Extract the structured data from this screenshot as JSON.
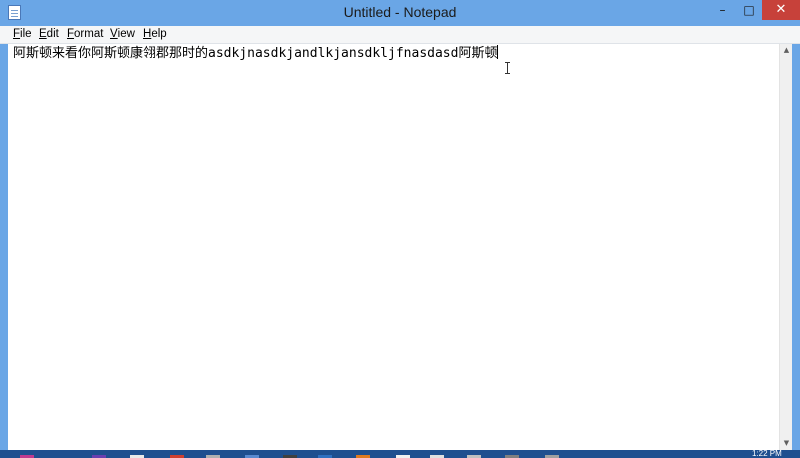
{
  "window": {
    "title": "Untitled - Notepad",
    "controls": {
      "minimize": "–",
      "maximize": "□",
      "close": "✕"
    }
  },
  "menu": {
    "items": [
      {
        "label": "File",
        "underline": "F",
        "rest": "ile"
      },
      {
        "label": "Edit",
        "underline": "E",
        "rest": "dit"
      },
      {
        "label": "Format",
        "underline": "F",
        "rest": "ormat"
      },
      {
        "label": "View",
        "underline": "V",
        "rest": "iew"
      },
      {
        "label": "Help",
        "underline": "H",
        "rest": "elp"
      }
    ]
  },
  "editor": {
    "content": "阿斯顿来看你阿斯顿康翎郡那时的asdkjnasdkjandlkjansdkljfnasdasd阿斯顿"
  },
  "scrollbar": {
    "up_arrow": "▲",
    "down_arrow": "▼"
  },
  "taskbar": {
    "clock": "1:22 PM",
    "icon_colors": [
      "#c03a8f",
      "#6a3fb0",
      "#e9e9e9",
      "#d04030",
      "#b0b0b0",
      "#5a8ad0",
      "#404040",
      "#3070c0",
      "#e07a20",
      "#f0f0f0",
      "#e0e0e0",
      "#c0c0c0",
      "#808080",
      "#a0a0a0"
    ]
  },
  "colors": {
    "title_background": "#6aa6e6",
    "close_button": "#c7413a",
    "menu_background": "#f5f6f7",
    "editor_background": "#ffffff"
  }
}
